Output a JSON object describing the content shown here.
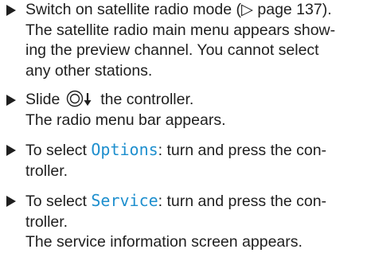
{
  "steps": [
    {
      "lines": [
        "Switch on satellite radio mode (▷ page 137).",
        "The satellite radio main menu appears show-",
        "ing the preview channel. You cannot select",
        "any other stations."
      ]
    },
    {
      "action_before": "Slide",
      "controller_icon": "controller-slide-down-icon",
      "action_after": "the controller.",
      "result": "The radio menu bar appears."
    },
    {
      "prefix": "To select",
      "menu_term": "Options",
      "line1_rest": ": turn and press the con-",
      "line2": "troller."
    },
    {
      "prefix": "To select",
      "menu_term": "Service",
      "line1_rest": ": turn and press the con-",
      "line2": "troller.",
      "result": "The service information screen appears."
    }
  ],
  "colors": {
    "text": "#1f1f1f",
    "menu_term": "#1e8fce"
  }
}
